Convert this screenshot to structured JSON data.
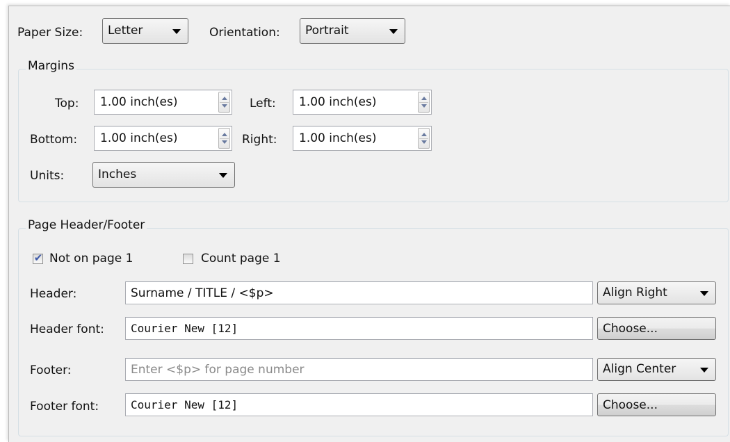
{
  "paper": {
    "size_label": "Paper Size:",
    "size_value": "Letter",
    "orientation_label": "Orientation:",
    "orientation_value": "Portrait"
  },
  "margins": {
    "title": "Margins",
    "top_label": "Top:",
    "top_value": "1.00 inch(es)",
    "left_label": "Left:",
    "left_value": "1.00 inch(es)",
    "bottom_label": "Bottom:",
    "bottom_value": "1.00 inch(es)",
    "right_label": "Right:",
    "right_value": "1.00 inch(es)",
    "units_label": "Units:",
    "units_value": "Inches"
  },
  "header_footer": {
    "title": "Page Header/Footer",
    "not_on_page1_label": "Not on page 1",
    "not_on_page1_checked": true,
    "count_page1_label": "Count page 1",
    "count_page1_checked": false,
    "header_label": "Header:",
    "header_value": "Surname / TITLE / <$p>",
    "header_align": "Align Right",
    "header_font_label": "Header font:",
    "header_font_value": "Courier New [12]",
    "header_font_button": "Choose...",
    "footer_label": "Footer:",
    "footer_value": "",
    "footer_placeholder": "Enter <$p> for page number",
    "footer_align": "Align Center",
    "footer_font_label": "Footer font:",
    "footer_font_value": "Courier New [12]",
    "footer_font_button": "Choose..."
  }
}
